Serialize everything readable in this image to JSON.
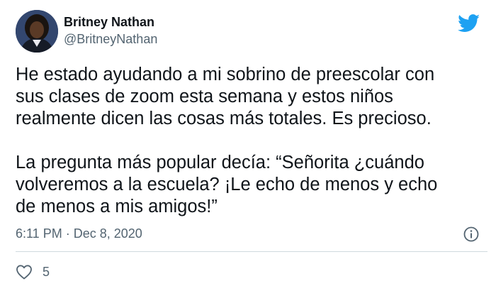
{
  "author": {
    "display_name": "Britney Nathan",
    "handle": "@BritneyNathan"
  },
  "tweet": {
    "text_paragraph_1": "He estado ayudando a mi sobrino de preescolar con\nsus clases de zoom esta semana y estos niños\nrealmente dicen las cosas más totales. Es precioso.",
    "text_paragraph_2": "La pregunta más popular decía: “Señorita ¿cuándo\nvolveremos a la escuela? ¡Le echo de menos y echo\nde menos a mis amigos!”",
    "timestamp": "6:11 PM · Dec 8, 2020",
    "like_count": "5"
  },
  "icons": {
    "brand": "twitter-bird-icon",
    "info": "info-icon",
    "like": "heart-icon"
  },
  "colors": {
    "twitter_blue": "#1da1f2",
    "text_primary": "#0f1419",
    "text_secondary": "#536471",
    "divider": "#cfd9de"
  }
}
